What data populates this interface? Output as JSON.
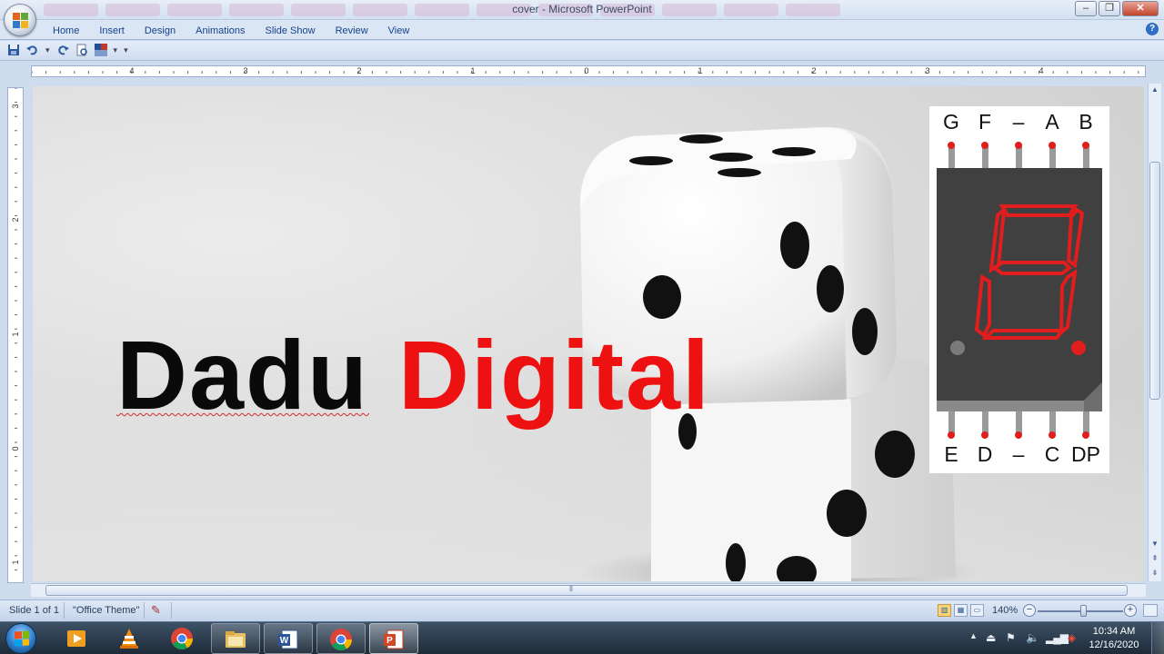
{
  "window": {
    "title": "cover - Microsoft PowerPoint",
    "minimize_glyph": "–",
    "restore_glyph": "❐",
    "close_glyph": "✕"
  },
  "ribbon": {
    "tabs": [
      "Home",
      "Insert",
      "Design",
      "Animations",
      "Slide Show",
      "Review",
      "View"
    ],
    "help_glyph": "?"
  },
  "qat": {
    "icons": [
      "save-icon",
      "undo-icon",
      "redo-icon",
      "print-preview-icon",
      "theme-colors-icon",
      "customize-qat-icon"
    ]
  },
  "ruler": {
    "horizontal_labels": [
      "4",
      "3",
      "2",
      "1",
      "0",
      "1",
      "2",
      "3",
      "4"
    ],
    "vertical_labels": [
      "3",
      "2",
      "1",
      "0",
      "1"
    ]
  },
  "slide": {
    "title_part1": "Dadu",
    "title_part2": "Digital",
    "title_part2_color": "#ee1111",
    "segment_display": {
      "top_pins": [
        "G",
        "F",
        "–",
        "A",
        "B"
      ],
      "bottom_pins": [
        "E",
        "D",
        "–",
        "C",
        "DP"
      ],
      "segment_color": "#e11d1d",
      "body_color": "#404040"
    }
  },
  "statusbar": {
    "slide_info": "Slide 1 of 1",
    "theme": "\"Office Theme\"",
    "zoom": "140%",
    "zoom_minus": "−",
    "zoom_plus": "+"
  },
  "taskbar": {
    "apps": [
      "media-player-icon",
      "vlc-icon",
      "chrome-icon",
      "file-explorer-icon",
      "word-icon",
      "chrome-icon",
      "powerpoint-icon"
    ],
    "clock_time": "10:34 AM",
    "clock_date": "12/16/2020"
  },
  "colors": {
    "ribbon_text": "#15428b",
    "accent_red": "#ee1111"
  }
}
